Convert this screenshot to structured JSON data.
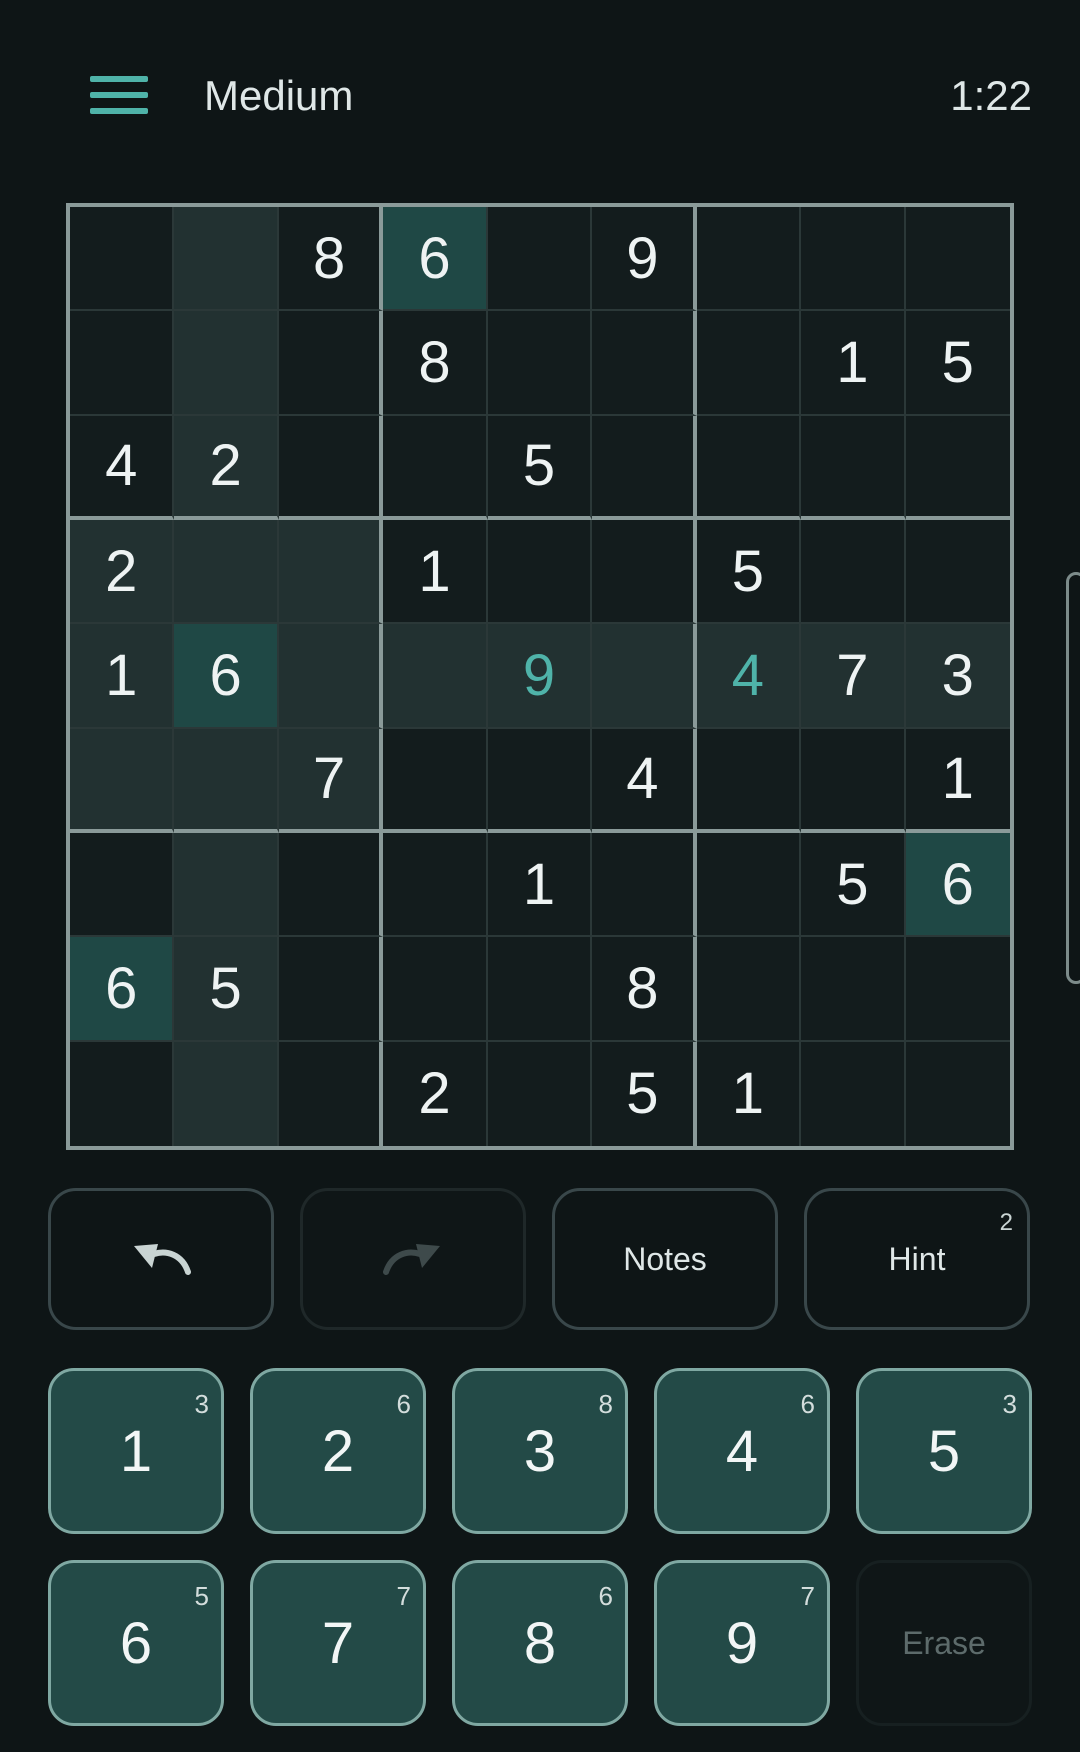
{
  "header": {
    "difficulty": "Medium",
    "timer": "1:22",
    "menu_icon": "hamburger-menu-icon"
  },
  "colors": {
    "background": "#0e1516",
    "accent": "#4fb3a9",
    "highlight": "#223131",
    "same_number_highlight": "#1f4845",
    "key_background": "#234a47"
  },
  "board": {
    "rows": [
      [
        "",
        "",
        "8",
        "6",
        "",
        "9",
        "",
        "",
        ""
      ],
      [
        "",
        "",
        "",
        "8",
        "",
        "",
        "",
        "1",
        "5"
      ],
      [
        "4",
        "2",
        "",
        "",
        "5",
        "",
        "",
        "",
        ""
      ],
      [
        "2",
        "",
        "",
        "1",
        "",
        "",
        "5",
        "",
        ""
      ],
      [
        "1",
        "6",
        "",
        "",
        "9",
        "",
        "4",
        "7",
        "3"
      ],
      [
        "",
        "",
        "7",
        "",
        "",
        "4",
        "",
        "",
        "1"
      ],
      [
        "",
        "",
        "",
        "",
        "1",
        "",
        "",
        "5",
        "6"
      ],
      [
        "6",
        "5",
        "",
        "",
        "",
        "8",
        "",
        "",
        ""
      ],
      [
        "",
        "",
        "",
        "2",
        "",
        "5",
        "1",
        "",
        ""
      ]
    ],
    "selected": {
      "row": 4,
      "col": 1,
      "value": "6"
    },
    "user_entries": [
      {
        "row": 4,
        "col": 4,
        "value": "9"
      },
      {
        "row": 4,
        "col": 6,
        "value": "4"
      }
    ]
  },
  "toolbar": {
    "undo_icon": "undo-icon",
    "redo_icon": "redo-icon",
    "redo_enabled": false,
    "notes_label": "Notes",
    "hint_label": "Hint",
    "hint_count": "2"
  },
  "numpad": {
    "keys": [
      {
        "digit": "1",
        "remaining": "3"
      },
      {
        "digit": "2",
        "remaining": "6"
      },
      {
        "digit": "3",
        "remaining": "8"
      },
      {
        "digit": "4",
        "remaining": "6"
      },
      {
        "digit": "5",
        "remaining": "3"
      },
      {
        "digit": "6",
        "remaining": "5"
      },
      {
        "digit": "7",
        "remaining": "7"
      },
      {
        "digit": "8",
        "remaining": "6"
      },
      {
        "digit": "9",
        "remaining": "7"
      }
    ],
    "erase_label": "Erase",
    "erase_enabled": false
  }
}
